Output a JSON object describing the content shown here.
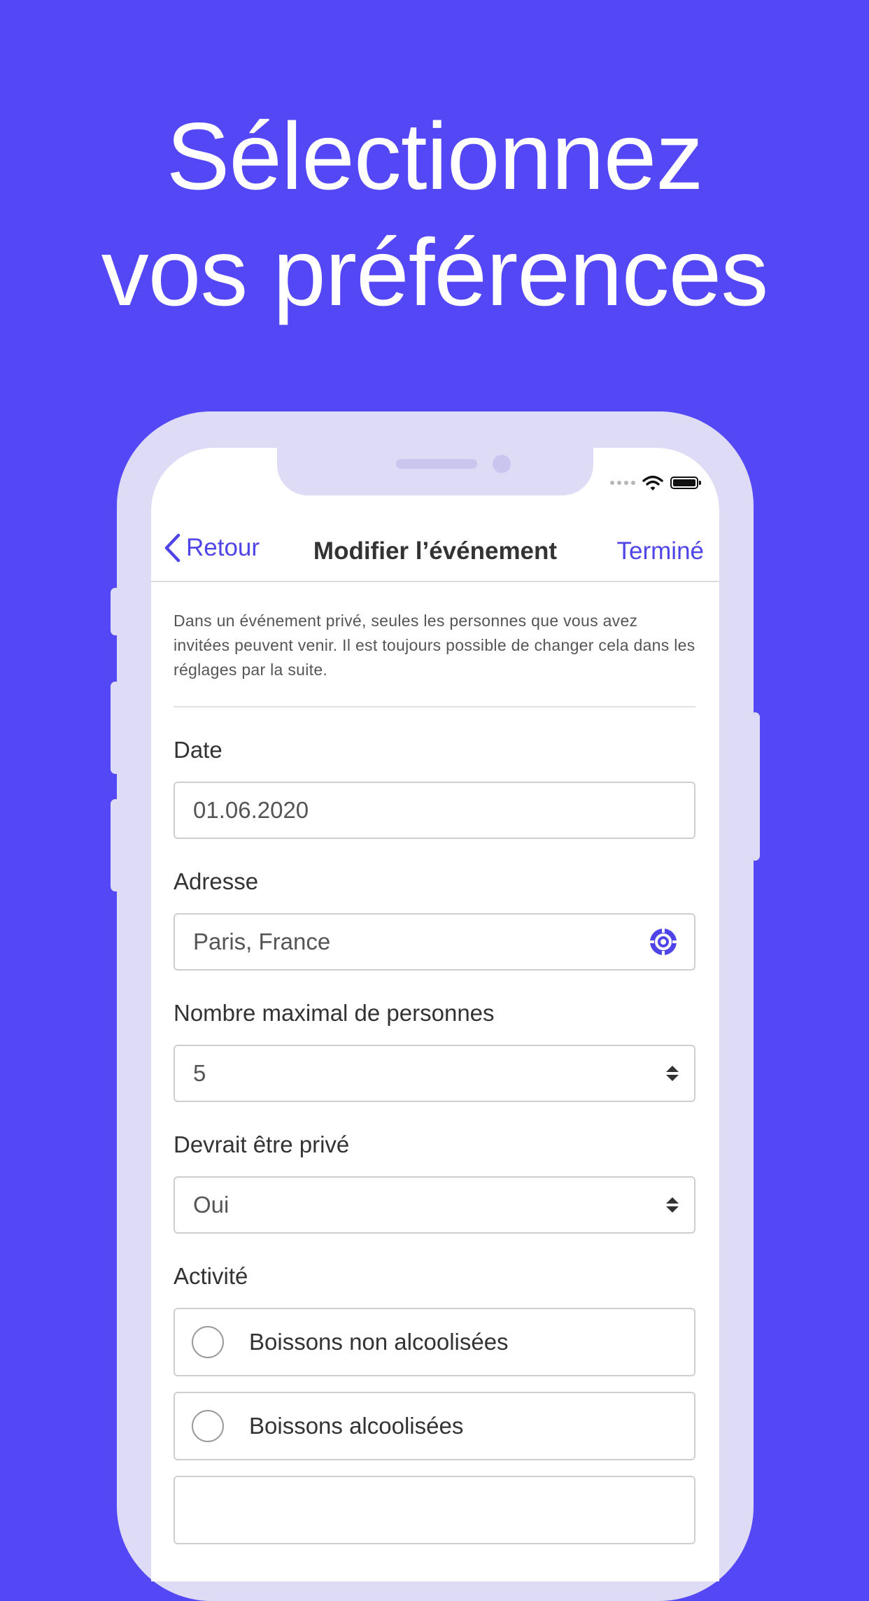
{
  "headline": {
    "line1": "Sélectionnez",
    "line2": "vos préférences"
  },
  "colors": {
    "background": "#5447F5",
    "accent": "#4F44E8",
    "phone_frame": "#DEDBF6"
  },
  "status_bar": {
    "icons": [
      "signal-dots-icon",
      "wifi-icon",
      "battery-icon"
    ]
  },
  "navbar": {
    "back_label": "Retour",
    "title": "Modifier l’événement",
    "done_label": "Terminé"
  },
  "info_text": "Dans un événement privé, seules les personnes que vous avez invitées peuvent venir. Il est toujours possible de changer cela dans les réglages par la suite.",
  "fields": {
    "date": {
      "label": "Date",
      "value": "01.06.2020"
    },
    "address": {
      "label": "Adresse",
      "value": "Paris, France",
      "icon": "locate-icon"
    },
    "max_people": {
      "label": "Nombre maximal de personnes",
      "value": "5",
      "icon": "updown-icon"
    },
    "private": {
      "label": "Devrait être privé",
      "value": "Oui",
      "icon": "updown-icon"
    },
    "activity": {
      "label": "Activité",
      "options": [
        {
          "label": "Boissons non alcoolisées",
          "selected": false
        },
        {
          "label": "Boissons alcoolisées",
          "selected": false
        }
      ]
    }
  }
}
